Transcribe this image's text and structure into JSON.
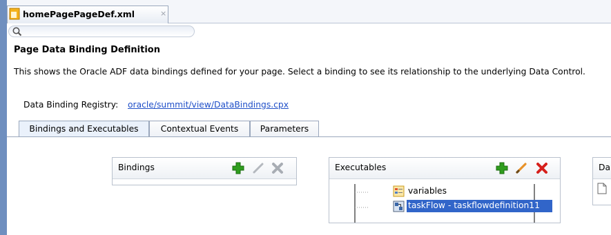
{
  "editor": {
    "tab_title": "homePagePageDef.xml",
    "tab_close": "×",
    "file_icon": "xml-file-icon"
  },
  "search": {
    "icon": "search-icon",
    "placeholder": ""
  },
  "page": {
    "heading": "Page Data Binding Definition",
    "description": "This shows the Oracle ADF data bindings defined for your page. Select a binding to see its relationship to the underlying Data Control.",
    "registry_label": "Data Binding Registry:",
    "registry_link": "oracle/summit/view/DataBindings.cpx"
  },
  "tabs": [
    {
      "label": "Bindings and Executables",
      "active": true
    },
    {
      "label": "Contextual Events",
      "active": false
    },
    {
      "label": "Parameters",
      "active": false
    }
  ],
  "bindings_panel": {
    "title": "Bindings",
    "tools": [
      "add-icon",
      "edit-icon",
      "delete-icon"
    ],
    "enabled": {
      "add": true,
      "edit": false,
      "delete": false
    }
  },
  "executables_panel": {
    "title": "Executables",
    "tools": [
      "add-icon",
      "edit-icon",
      "delete-icon"
    ],
    "enabled": {
      "add": true,
      "edit": true,
      "delete": true
    },
    "items": [
      {
        "label": "variables",
        "icon": "variables-icon",
        "selected": false
      },
      {
        "label": "taskFlow - taskflowdefinition11",
        "icon": "taskflow-icon",
        "selected": true
      }
    ]
  },
  "datacontrol_panel": {
    "title": "Da"
  },
  "colors": {
    "accent": "#3165c9",
    "link": "#1f4fc8",
    "add_green": "#2f9d1e",
    "delete_red": "#d6201c",
    "edit_orange": "#e8922a"
  }
}
